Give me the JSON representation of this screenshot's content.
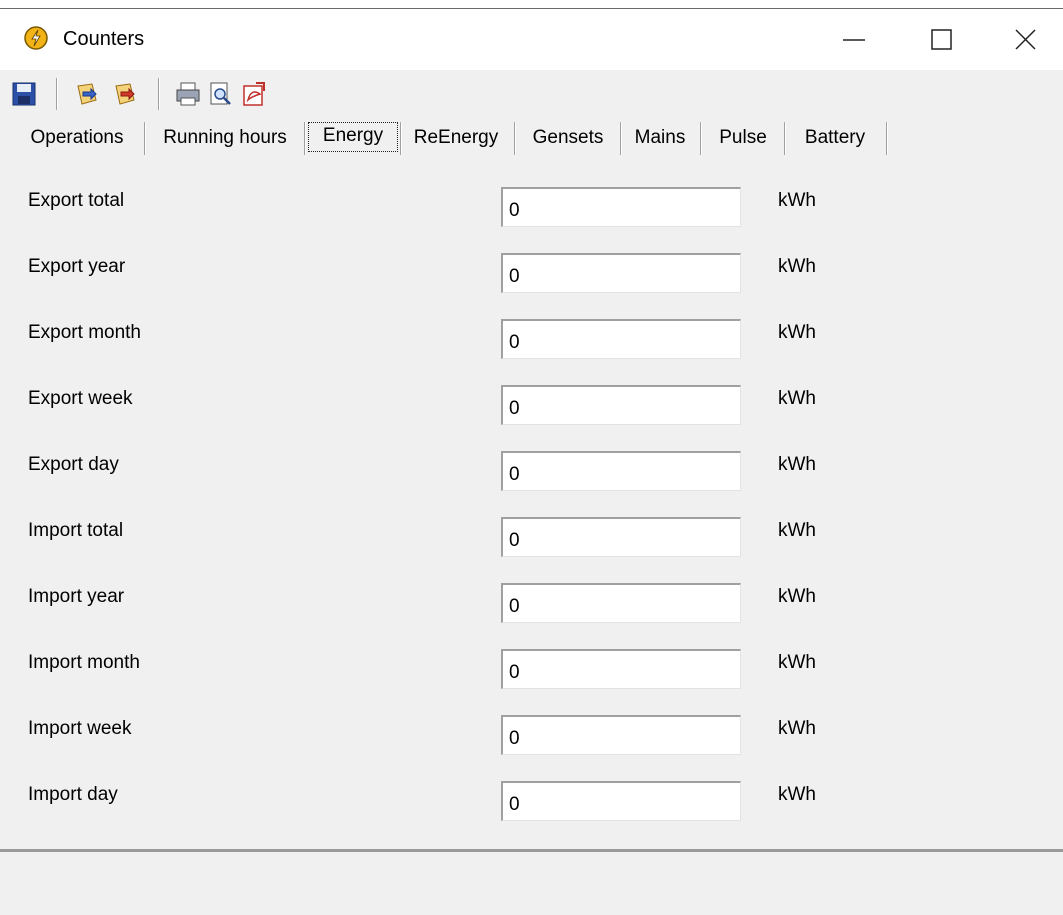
{
  "window": {
    "title": "Counters"
  },
  "toolbar": {
    "icons": [
      "save-icon",
      "import-icon",
      "export-icon",
      "print-icon",
      "print-preview-icon",
      "export-pdf-icon"
    ]
  },
  "tabs": [
    {
      "label": "Operations"
    },
    {
      "label": "Running hours"
    },
    {
      "label": "Energy",
      "active": true
    },
    {
      "label": "ReEnergy"
    },
    {
      "label": "Gensets"
    },
    {
      "label": "Mains"
    },
    {
      "label": "Pulse"
    },
    {
      "label": "Battery"
    }
  ],
  "rows": [
    {
      "label": "Export total",
      "value": "0",
      "unit": "kWh"
    },
    {
      "label": "Export year",
      "value": "0",
      "unit": "kWh"
    },
    {
      "label": "Export month",
      "value": "0",
      "unit": "kWh"
    },
    {
      "label": "Export week",
      "value": "0",
      "unit": "kWh"
    },
    {
      "label": "Export day",
      "value": "0",
      "unit": "kWh"
    },
    {
      "label": "Import total",
      "value": "0",
      "unit": "kWh"
    },
    {
      "label": "Import year",
      "value": "0",
      "unit": "kWh"
    },
    {
      "label": "Import month",
      "value": "0",
      "unit": "kWh"
    },
    {
      "label": "Import week",
      "value": "0",
      "unit": "kWh"
    },
    {
      "label": "Import day",
      "value": "0",
      "unit": "kWh"
    }
  ],
  "colors": {
    "window_bg": "#f0f0f0",
    "field_bg": "#ffffff"
  }
}
